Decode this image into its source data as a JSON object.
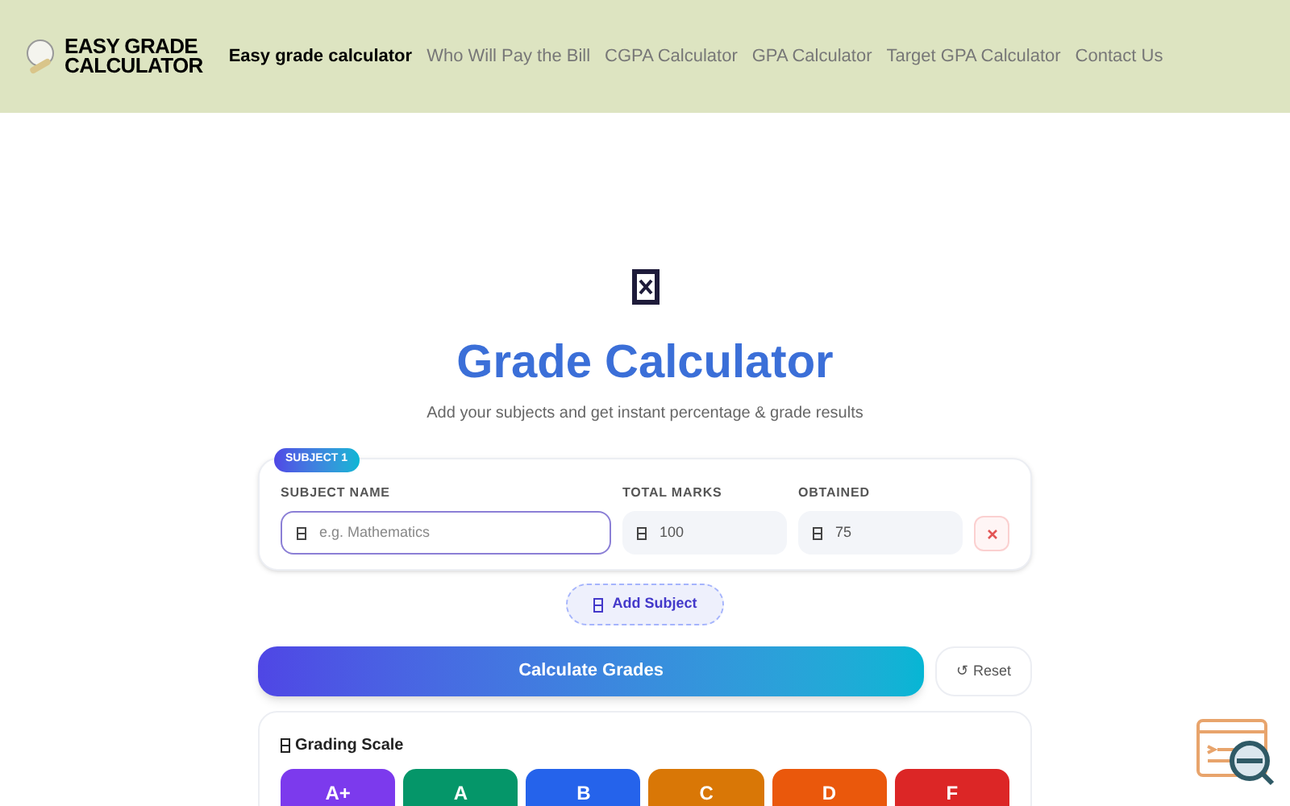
{
  "header": {
    "logo": [
      "EASY GRADE",
      "CALCULATOR"
    ],
    "nav": [
      {
        "label": "Easy grade calculator",
        "selected": true
      },
      {
        "label": "Who Will Pay the Bill",
        "selected": false
      },
      {
        "label": "CGPA Calculator",
        "selected": false
      },
      {
        "label": "GPA Calculator",
        "selected": false
      },
      {
        "label": "Target GPA Calculator",
        "selected": false
      },
      {
        "label": "Contact Us",
        "selected": false
      }
    ]
  },
  "title": "Grade Calculator",
  "subtitle": "Add your subjects and get instant percentage & grade results",
  "subject": {
    "badge": "SUBJECT 1",
    "fields": [
      {
        "label": "SUBJECT NAME",
        "placeholder": "e.g. Mathematics"
      },
      {
        "label": "TOTAL MARKS",
        "value": "100"
      },
      {
        "label": "OBTAINED",
        "value": "75"
      }
    ]
  },
  "add_button": "Add Subject",
  "calculate_button": "Calculate Grades",
  "reset_button": "↺ Reset",
  "grading": {
    "title": "Grading Scale",
    "grades": [
      {
        "label": "A+",
        "color": "#7c3aed"
      },
      {
        "label": "A",
        "color": "#059669"
      },
      {
        "label": "B",
        "color": "#2563eb"
      },
      {
        "label": "C",
        "color": "#d97706"
      },
      {
        "label": "D",
        "color": "#ea580c"
      },
      {
        "label": "F",
        "color": "#dc2626"
      }
    ]
  }
}
